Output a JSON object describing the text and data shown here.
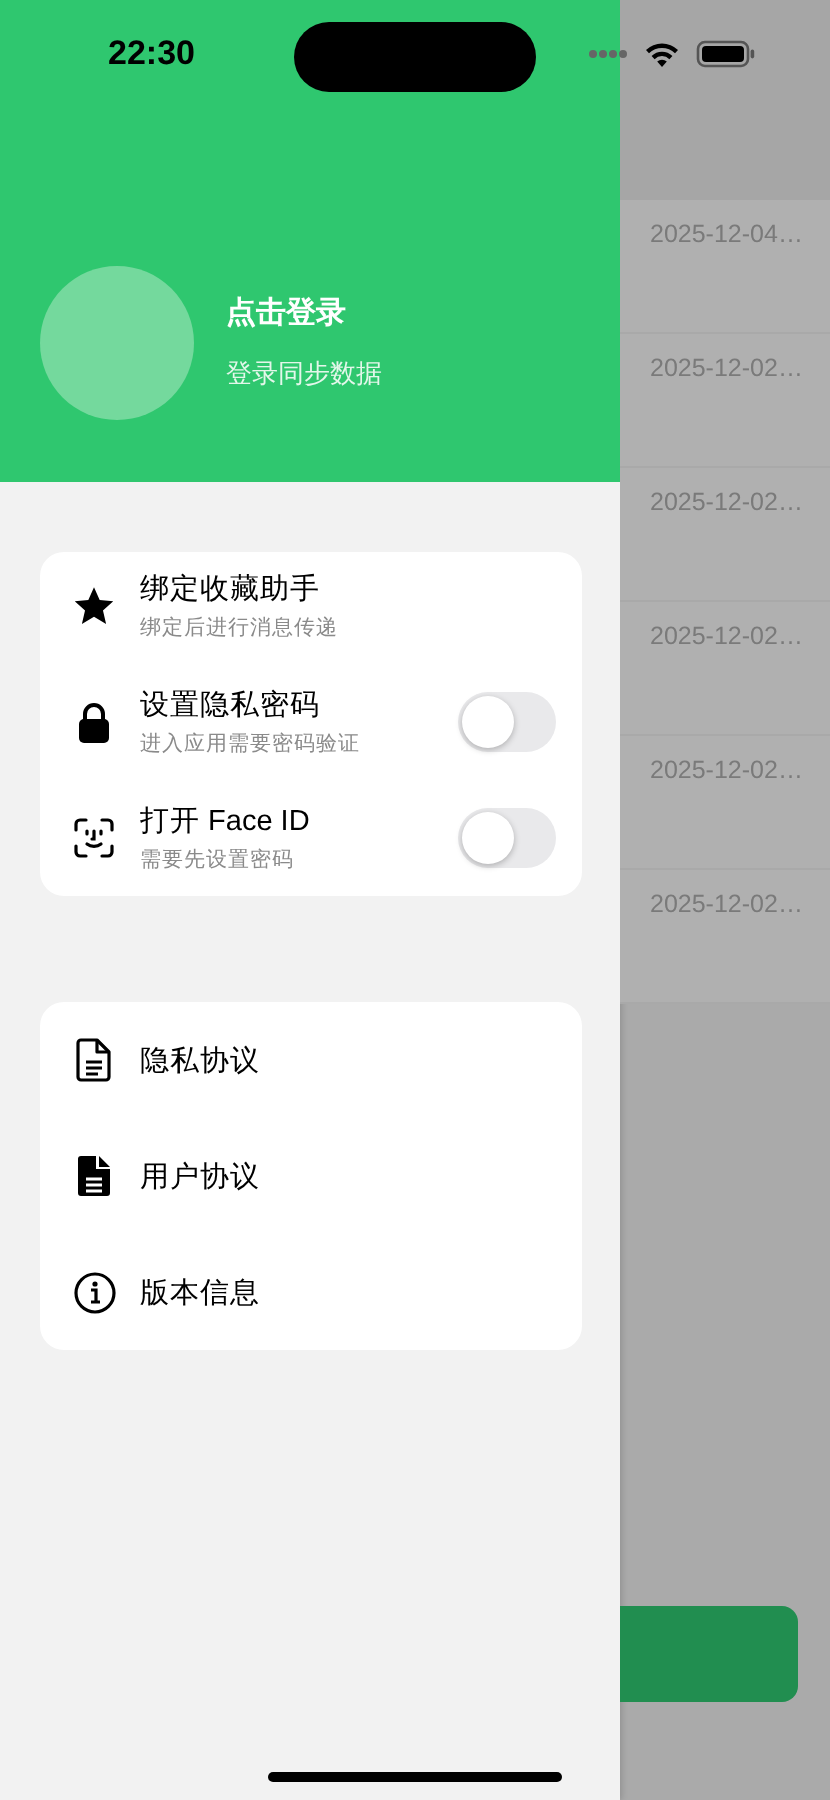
{
  "status_bar": {
    "time": "22:30"
  },
  "drawer": {
    "profile": {
      "title": "点击登录",
      "subtitle": "登录同步数据"
    },
    "settings": [
      {
        "kind": "action",
        "title": "绑定收藏助手",
        "subtitle": "绑定后进行消息传递"
      },
      {
        "kind": "toggle",
        "title": "设置隐私密码",
        "subtitle": "进入应用需要密码验证",
        "on": false
      },
      {
        "kind": "toggle",
        "title": "打开 Face ID",
        "subtitle": "需要先设置密码",
        "on": false
      }
    ],
    "links": [
      {
        "label": "隐私协议"
      },
      {
        "label": "用户协议"
      },
      {
        "label": "版本信息"
      }
    ]
  },
  "background": {
    "rows": [
      {
        "date": "2025-12-04…"
      },
      {
        "date": "2025-12-02…"
      },
      {
        "date": "2025-12-02…"
      },
      {
        "date": "2025-12-02…"
      },
      {
        "date": "2025-12-02…"
      },
      {
        "date": "2025-12-02…"
      }
    ]
  }
}
